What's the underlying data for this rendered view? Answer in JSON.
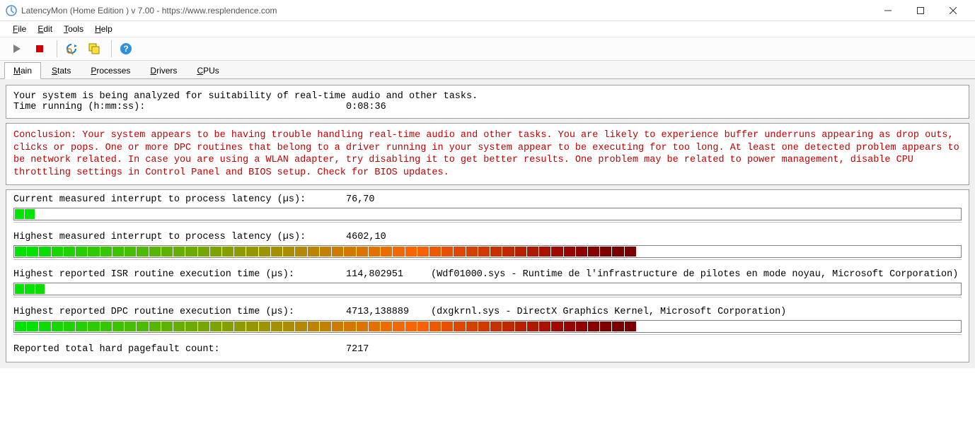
{
  "titlebar": {
    "text": "LatencyMon  (Home Edition )  v 7.00 - https://www.resplendence.com"
  },
  "menubar": {
    "items": [
      {
        "label": "File",
        "ul": "F"
      },
      {
        "label": "Edit",
        "ul": "E"
      },
      {
        "label": "Tools",
        "ul": "T"
      },
      {
        "label": "Help",
        "ul": "H"
      }
    ]
  },
  "toolbar": {
    "play_icon": "play-icon",
    "stop_icon": "stop-icon",
    "refresh_icon": "refresh-icon",
    "copy_icon": "copy-icon",
    "help_icon": "help-icon"
  },
  "tabs": [
    {
      "label": "Main",
      "ul": "M",
      "active": true
    },
    {
      "label": "Stats",
      "ul": "S",
      "active": false
    },
    {
      "label": "Processes",
      "ul": "P",
      "active": false
    },
    {
      "label": "Drivers",
      "ul": "D",
      "active": false
    },
    {
      "label": "CPUs",
      "ul": "C",
      "active": false
    }
  ],
  "analysis": {
    "line1": "Your system is being analyzed for suitability of real-time audio and other tasks.",
    "line2_label": "Time running (h:mm:ss):",
    "line2_value": "0:08:36"
  },
  "conclusion": "Conclusion: Your system appears to be having trouble handling real-time audio and other tasks. You are likely to experience buffer underruns appearing as drop outs, clicks or pops. One or more DPC routines that belong to a driver running in your system appear to be executing for too long. At least one detected problem appears to be network related. In case you are using a WLAN adapter, try disabling it to get better results. One problem may be related to power management, disable CPU throttling settings in Control Panel and BIOS setup. Check for BIOS updates.",
  "metrics": {
    "m0": {
      "label": "Current measured interrupt to process latency (µs):",
      "value": "76,70",
      "extra": "",
      "bar_segs": 2,
      "bar_fill_pct": 2
    },
    "m1": {
      "label": "Highest measured interrupt to process latency (µs):",
      "value": "4602,10",
      "extra": "",
      "bar_segs": 51,
      "bar_fill_pct": 62
    },
    "m2": {
      "label": "Highest reported ISR routine execution time (µs):",
      "value": "114,802951",
      "extra": "(Wdf01000.sys - Runtime de l'infrastructure de pilotes en mode noyau, Microsoft Corporation)",
      "bar_segs": 3,
      "bar_fill_pct": 3
    },
    "m3": {
      "label": "Highest reported DPC routine execution time (µs):",
      "value": "4713,138889",
      "extra": "(dxgkrnl.sys - DirectX Graphics Kernel, Microsoft Corporation)",
      "bar_segs": 51,
      "bar_fill_pct": 62
    },
    "m4": {
      "label": "Reported total hard pagefault count:",
      "value": "7217",
      "extra": ""
    }
  },
  "bar_colors_full": [
    "#00e400",
    "#00e400",
    "#0cdc00",
    "#14d800",
    "#1cd400",
    "#24d000",
    "#2ccc00",
    "#34c800",
    "#3cc400",
    "#44c000",
    "#4cbc00",
    "#54b800",
    "#5cb400",
    "#64b000",
    "#6cac00",
    "#74a800",
    "#7ca400",
    "#84a000",
    "#8c9c00",
    "#949800",
    "#9c9400",
    "#a49000",
    "#ac8c00",
    "#b48800",
    "#bc8400",
    "#c48000",
    "#cc7c00",
    "#d47800",
    "#dc7400",
    "#e47000",
    "#ec6c00",
    "#f46800",
    "#fc6400",
    "#f86000",
    "#f05800",
    "#e85000",
    "#e04800",
    "#d84000",
    "#d03800",
    "#c83000",
    "#c02800",
    "#b82000",
    "#b01800",
    "#a81000",
    "#a00800",
    "#980400",
    "#900000",
    "#880000",
    "#800000",
    "#780000",
    "#780000"
  ]
}
